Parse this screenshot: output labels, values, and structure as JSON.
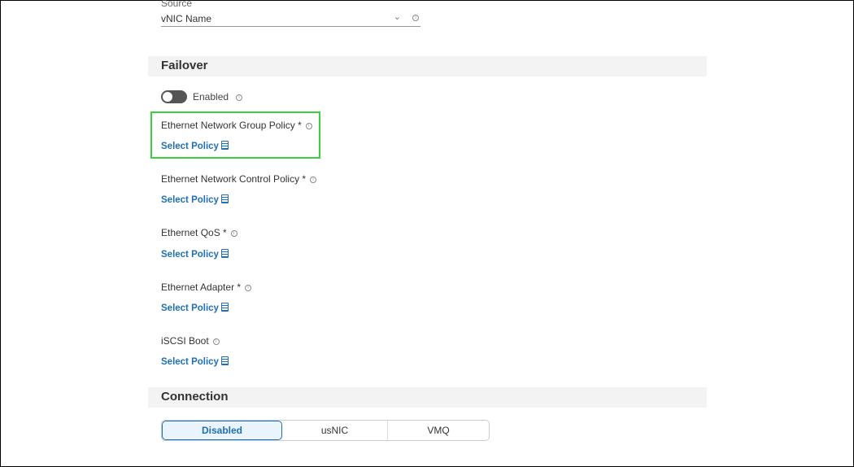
{
  "source": {
    "label": "Source",
    "value": "vNIC Name"
  },
  "failover": {
    "title": "Failover",
    "toggle_label": "Enabled",
    "toggle_on": false
  },
  "policies": [
    {
      "label": "Ethernet Network Group Policy *",
      "link": "Select Policy"
    },
    {
      "label": "Ethernet Network Control Policy *",
      "link": "Select Policy"
    },
    {
      "label": "Ethernet QoS *",
      "link": "Select Policy"
    },
    {
      "label": "Ethernet Adapter *",
      "link": "Select Policy"
    },
    {
      "label": "iSCSI Boot",
      "link": "Select Policy"
    }
  ],
  "connection": {
    "title": "Connection",
    "options": [
      "Disabled",
      "usNIC",
      "VMQ"
    ],
    "selected": "Disabled"
  },
  "colors": {
    "accent": "#1f6fb5",
    "highlight": "#3ecf3e"
  }
}
